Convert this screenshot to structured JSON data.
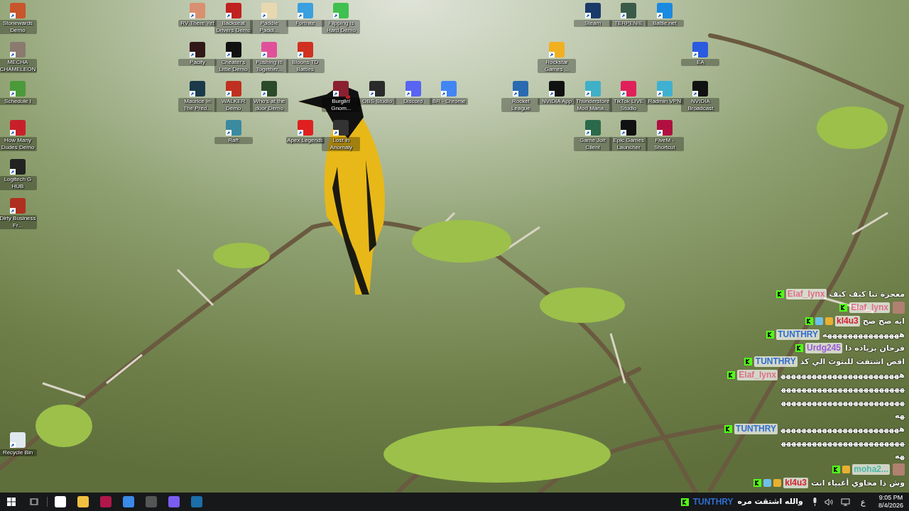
{
  "desktop_icons": [
    {
      "label": "Stonewards Demo"
    },
    {
      "label": "MECHA CHAMELEON"
    },
    {
      "label": "Schedule I"
    },
    {
      "label": "How Many Dudes Demo"
    },
    {
      "label": "Logitech G HUB"
    },
    {
      "label": "Dirty Business Fr..."
    },
    {
      "label": "Recycle Bin"
    },
    {
      "label": "RV There Yet"
    },
    {
      "label": "Backseat Drivers Demo"
    },
    {
      "label": "Paddle Paddl..."
    },
    {
      "label": "Fortnite"
    },
    {
      "label": "Flipping is Hard Demo"
    },
    {
      "label": "Pacify"
    },
    {
      "label": "Cheater's Little Demo"
    },
    {
      "label": "Pushing It! Together..."
    },
    {
      "label": "Bloons TD Battles"
    },
    {
      "label": "Maurice In The Pred..."
    },
    {
      "label": "WALKER Demo"
    },
    {
      "label": "Who's at the door Demo"
    },
    {
      "label": "Burglin' Gnom..."
    },
    {
      "label": "OBS Studio"
    },
    {
      "label": "Discord"
    },
    {
      "label": "BR - Chrome"
    },
    {
      "label": "Raft"
    },
    {
      "label": "Apex Legends"
    },
    {
      "label": "Lost in Anomaly"
    },
    {
      "label": "Steam"
    },
    {
      "label": "TERPENIE"
    },
    {
      "label": "Battle.net"
    },
    {
      "label": "Rockstar Games ..."
    },
    {
      "label": "EA"
    },
    {
      "label": "Rocket League"
    },
    {
      "label": "NVIDIA App"
    },
    {
      "label": "Thunderstore Mod Mana..."
    },
    {
      "label": "TikTok LIVE Studio"
    },
    {
      "label": "Radmin VPN"
    },
    {
      "label": "NVIDIA Broadcast"
    },
    {
      "label": "Game Jolt Client"
    },
    {
      "label": "Epic Games Launcher"
    },
    {
      "label": "FiveM - Shortcut"
    }
  ],
  "chat": [
    {
      "user": "Elaf_lynx",
      "color": "#e0708a",
      "subscriber": false,
      "crown": false,
      "kind": "text",
      "message": "معجزة تبا كيف كيف"
    },
    {
      "user": "Elaf_lynx",
      "color": "#e0708a",
      "subscriber": false,
      "crown": false,
      "kind": "emote"
    },
    {
      "user": "kl4u3",
      "color": "#d42030",
      "subscriber": true,
      "crown": true,
      "kind": "text",
      "message": "ايه صح صح"
    },
    {
      "user": "TUNTHRY",
      "color": "#2f6fd0",
      "subscriber": false,
      "crown": false,
      "kind": "text",
      "message": "هههههههههههههههه"
    },
    {
      "user": "Urdg245",
      "color": "#9b5ad8",
      "subscriber": false,
      "crown": false,
      "kind": "text",
      "message": "فرحان بزياده دا"
    },
    {
      "user": "TUNTHRY",
      "color": "#2f6fd0",
      "subscriber": false,
      "crown": false,
      "kind": "text",
      "message": "اقص اشتقت للبثوث الي كذ"
    },
    {
      "user": "Elaf_lynx",
      "color": "#e0708a",
      "subscriber": false,
      "crown": false,
      "kind": "text",
      "message": "هههههههههههههههههههههههههههههههههههههههههههههههههههههههههههههههههههههههههه"
    },
    {
      "user": "TUNTHRY",
      "color": "#2f6fd0",
      "subscriber": false,
      "crown": false,
      "kind": "text",
      "message": "هههههههههههههههههههههههههههههههههههههههههههههههههه"
    },
    {
      "user": "moha2...",
      "color": "#4fb8a8",
      "subscriber": false,
      "crown": true,
      "kind": "emote"
    },
    {
      "user": "kl4u3",
      "color": "#d42030",
      "subscriber": true,
      "crown": true,
      "kind": "text",
      "message": "وش ذا مخاوي أغبياء انت"
    }
  ],
  "taskbar": {
    "chat": {
      "user": "TUNTHRY",
      "color": "#2f6fd0",
      "message": "والله اشتقت مره"
    },
    "language": "ع",
    "time": "9:05 PM",
    "date": "8/4/2026"
  }
}
